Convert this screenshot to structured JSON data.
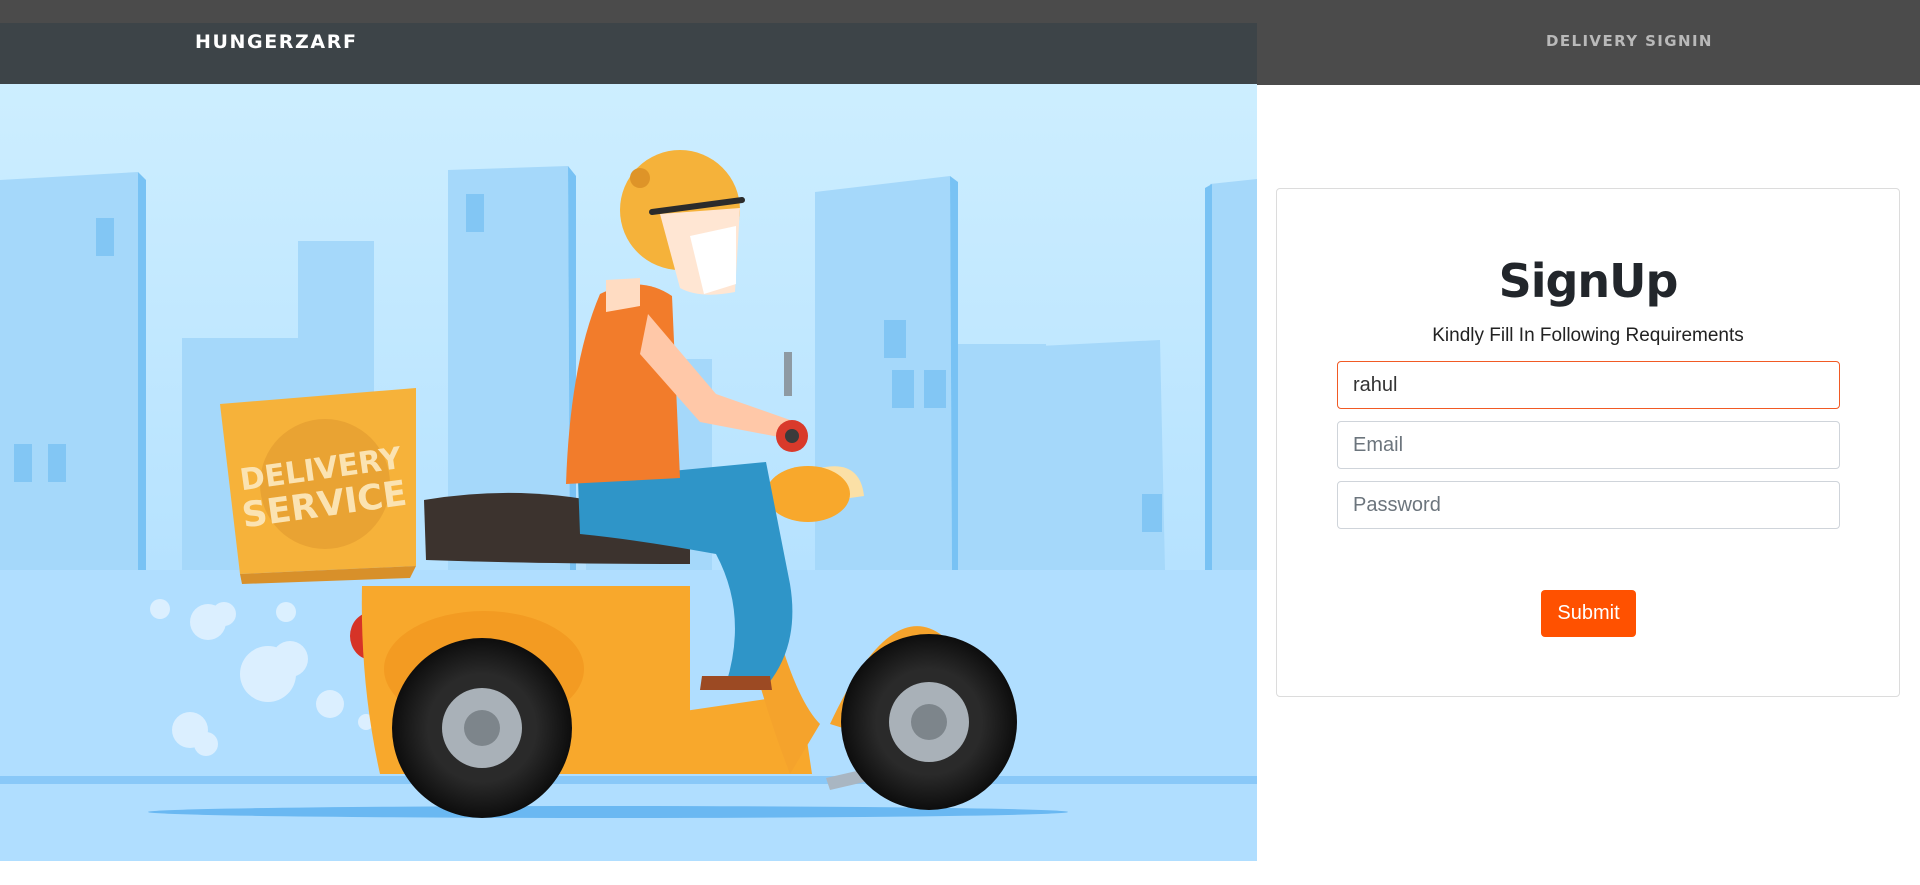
{
  "navbar": {
    "brand": "HUNGERZARF",
    "link": "DELIVERY SIGNIN"
  },
  "hero": {
    "box_text_line1": "DELIVERY",
    "box_text_line2": "SERVICE"
  },
  "signup": {
    "title": "SignUp",
    "subtitle": "Kindly Fill In Following Requirements",
    "name_value": "rahul",
    "email_placeholder": "Email",
    "password_placeholder": "Password",
    "submit_label": "Submit"
  },
  "colors": {
    "navbar_left": "#3d4448",
    "navbar_right": "#4b4b4b",
    "accent": "#ff5100",
    "hero_sky": "#cdeeff"
  }
}
